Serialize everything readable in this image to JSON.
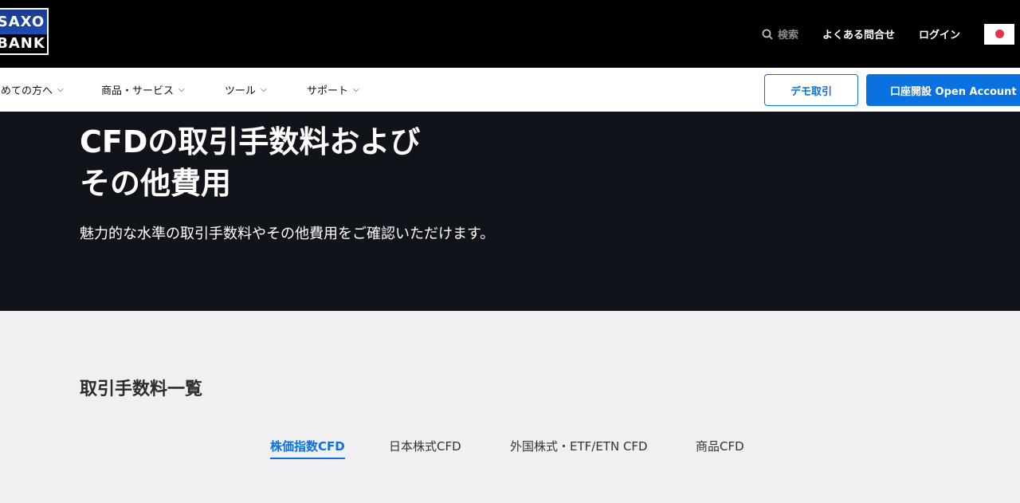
{
  "logo": {
    "line1": "SAXO",
    "line2": "BANK"
  },
  "topbar": {
    "search_label": "検索",
    "faq_label": "よくある問合せ",
    "login_label": "ログイン"
  },
  "nav": {
    "items": [
      {
        "label": "初めての方へ"
      },
      {
        "label": "商品・サービス"
      },
      {
        "label": "ツール"
      },
      {
        "label": "サポート"
      }
    ],
    "demo_label": "デモ取引",
    "open_label": "口座開設 Open Account"
  },
  "hero": {
    "title_line1": "CFDの取引手数料および",
    "title_line2": "その他費用",
    "subtitle": "魅力的な水準の取引手数料やその他費用をご確認いただけます。"
  },
  "section": {
    "title": "取引手数料一覧",
    "tabs": [
      {
        "label": "株価指数CFD"
      },
      {
        "label": "日本株式CFD"
      },
      {
        "label": "外国株式・ETF/ETN CFD"
      },
      {
        "label": "商品CFD"
      }
    ]
  },
  "colors": {
    "accent": "#0a71e0",
    "hero_bg": "#10131a",
    "page_bg": "#f0f0f2"
  }
}
